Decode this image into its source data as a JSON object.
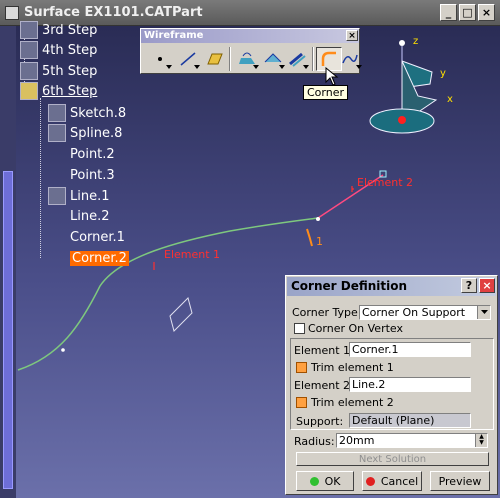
{
  "window": {
    "title": "Surface EX1101.CATPart"
  },
  "tree": {
    "items": [
      {
        "label": "3rd Step"
      },
      {
        "label": "4th Step"
      },
      {
        "label": "5th Step"
      },
      {
        "label": "6th Step"
      },
      {
        "label": "Sketch.8"
      },
      {
        "label": "Spline.8"
      },
      {
        "label": "Point.2"
      },
      {
        "label": "Point.3"
      },
      {
        "label": "Line.1"
      },
      {
        "label": "Line.2"
      },
      {
        "label": "Corner.1"
      },
      {
        "label": "Corner.2"
      }
    ]
  },
  "wireframe_toolbar": {
    "title": "Wireframe",
    "close": "×"
  },
  "tooltip": {
    "text": "Corner"
  },
  "viewport": {
    "element1_label": "Element 1",
    "element2_label": "Element 2",
    "radius_marker": "1",
    "axis_z": "z",
    "axis_y": "y",
    "axis_x": "x"
  },
  "dialog": {
    "title": "Corner Definition",
    "help": "?",
    "close": "×",
    "corner_type_label": "Corner Type:",
    "corner_type_value": "Corner On Support",
    "corner_on_vertex_label": "Corner On Vertex",
    "corner_on_vertex_checked": false,
    "element1_label": "Element 1:",
    "element1_value": "Corner.1",
    "trim1_label": "Trim element 1",
    "trim1_checked": true,
    "element2_label": "Element 2:",
    "element2_value": "Line.2",
    "trim2_label": "Trim element 2",
    "trim2_checked": true,
    "support_label": "Support:",
    "support_value": "Default (Plane)",
    "radius_label": "Radius:",
    "radius_value": "20mm",
    "next_solution": "Next Solution",
    "ok": "OK",
    "cancel": "Cancel",
    "preview": "Preview"
  },
  "colors": {
    "curve": "#7ec87e",
    "highlight": "#ff4a80",
    "selection": "#ff6a00",
    "label_red": "#ff3030"
  }
}
